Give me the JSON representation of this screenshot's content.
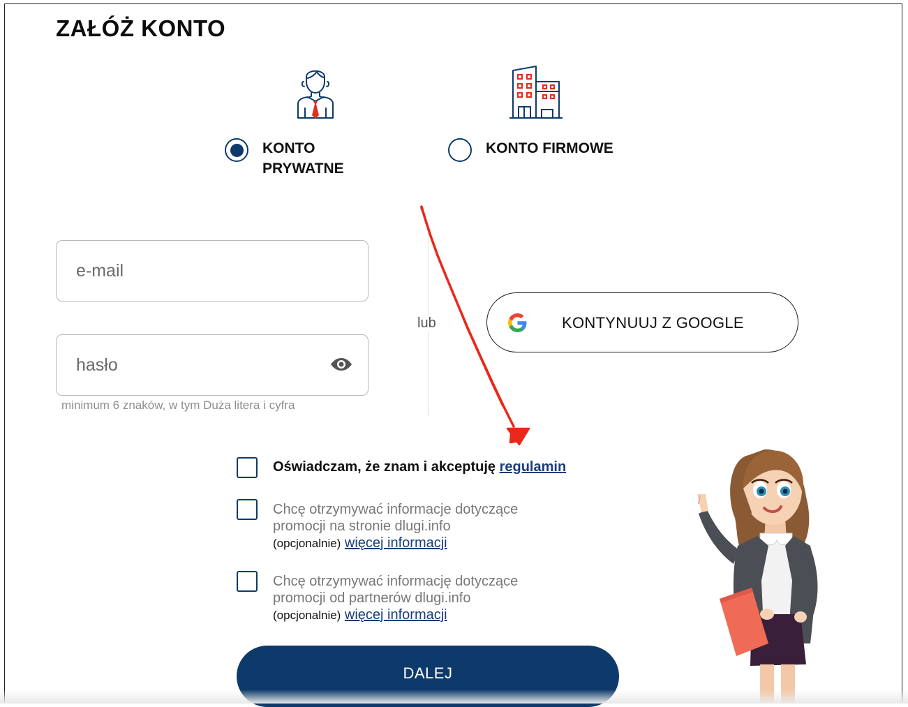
{
  "page": {
    "title": "ZAŁÓŻ KONTO"
  },
  "account_types": [
    {
      "label": "KONTO\nPRYWATNE",
      "selected": true,
      "icon": "person-icon"
    },
    {
      "label": "KONTO FIRMOWE",
      "selected": false,
      "icon": "building-icon"
    }
  ],
  "form": {
    "email_placeholder": "e-mail",
    "password_placeholder": "hasło",
    "password_hint": "minimum 6 znaków, w tym Duża litera i cyfra",
    "separator": "lub",
    "google_label": "KONTYNUUJ Z GOOGLE"
  },
  "consents": [
    {
      "text": "Oświadczam, że znam i akceptuję ",
      "link": "regulamin",
      "optional": ""
    },
    {
      "text": "Chcę otrzymywać informacje dotyczące promocji na stronie dlugi.info",
      "optional": "(opcjonalnie)",
      "link": "więcej informacji"
    },
    {
      "text": "Chcę otrzymywać informację dotyczące promocji od partnerów dlugi.info",
      "optional": "(opcjonalnie)",
      "link": "więcej informacji"
    }
  ],
  "actions": {
    "next_label": "DALEJ"
  },
  "colors": {
    "primary": "#0d3a6a",
    "accent": "#e0301e",
    "annotation_arrow": "#e8281a"
  }
}
